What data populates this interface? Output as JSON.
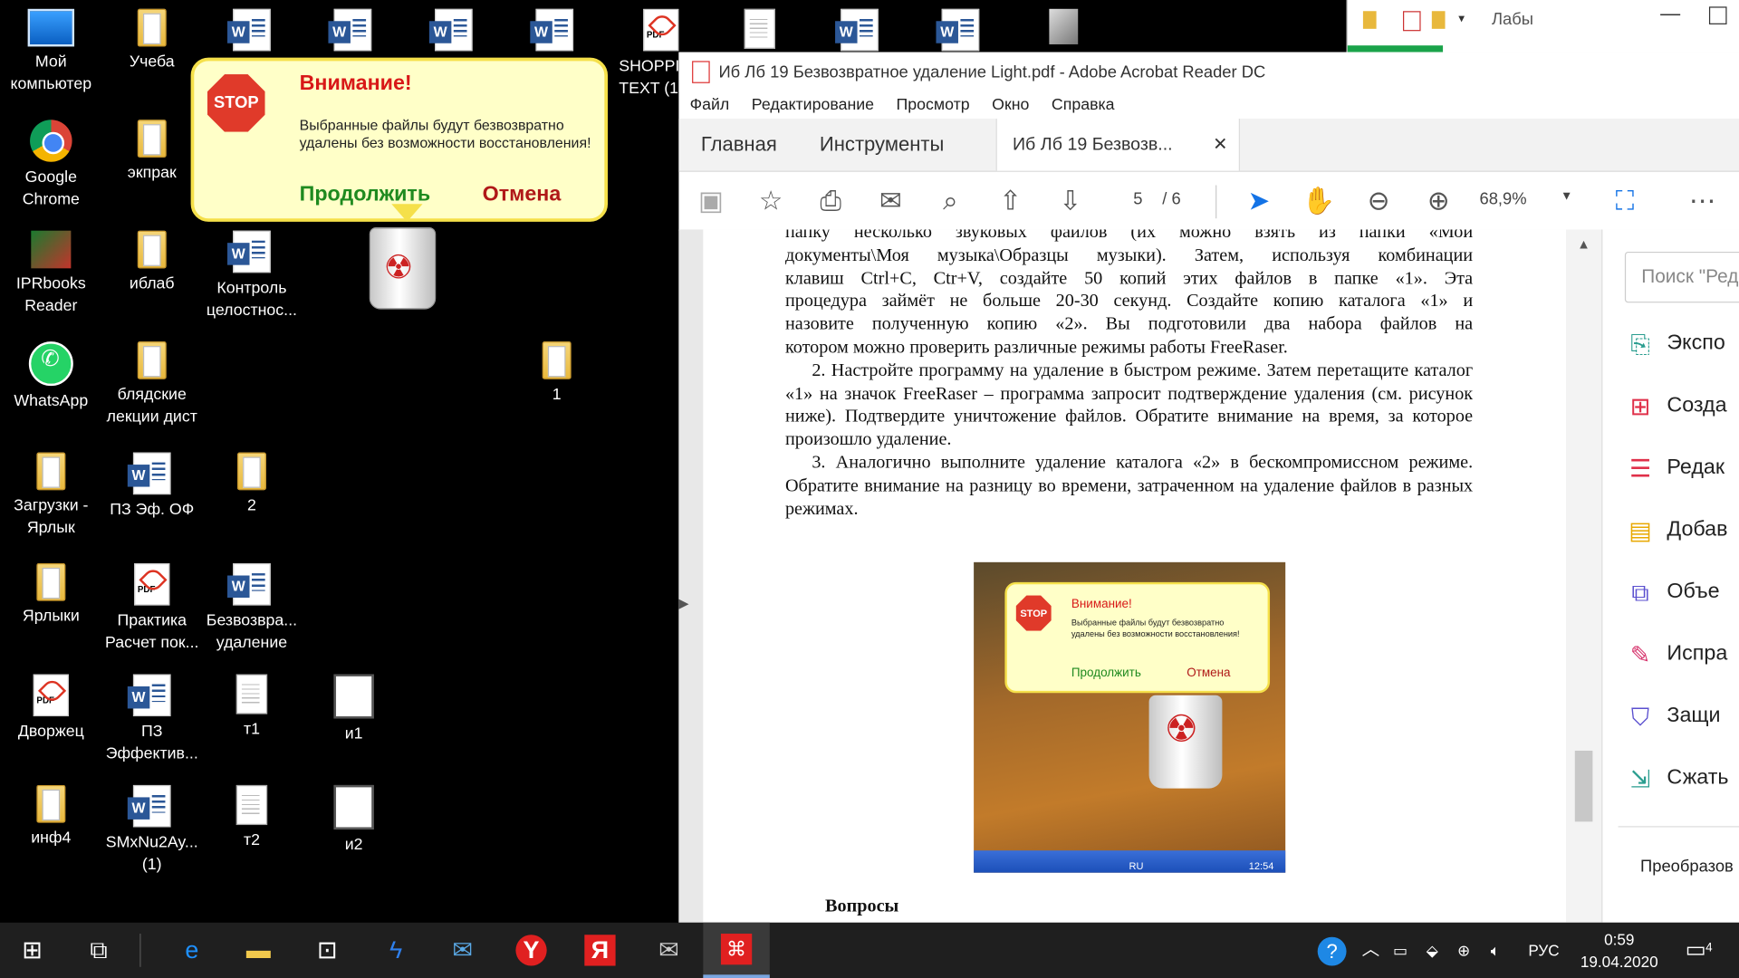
{
  "desktop": {
    "icons": [
      {
        "label": "Мой компьютер"
      },
      {
        "label": "Учеба"
      },
      {
        "label": "Google Chrome"
      },
      {
        "label": "экпрак"
      },
      {
        "label": "IPRbooks Reader"
      },
      {
        "label": "иблаб"
      },
      {
        "label": "Контроль целостнос..."
      },
      {
        "label": "WhatsApp"
      },
      {
        "label": "блядские лекции дист"
      },
      {
        "label": "1"
      },
      {
        "label": "Загрузки - Ярлык"
      },
      {
        "label": "ПЗ Эф. ОФ"
      },
      {
        "label": "2"
      },
      {
        "label": "Ярлыки"
      },
      {
        "label": "Практика Расчет пок..."
      },
      {
        "label": "Безвозвра... удаление"
      },
      {
        "label": "Дворжец"
      },
      {
        "label": "ПЗ Эффектив..."
      },
      {
        "label": "т1"
      },
      {
        "label": "и1"
      },
      {
        "label": "инф4"
      },
      {
        "label": "SMxNu2Ay... (1)"
      },
      {
        "label": "т2"
      },
      {
        "label": "и2"
      },
      {
        "label": "SHOPPI TEXT (1"
      }
    ]
  },
  "popup": {
    "stop": "STOP",
    "title": "Внимание!",
    "line1": "Выбранные файлы будут безвозвратно",
    "line2": "удалены без возможности восстановления!",
    "continue": "Продолжить",
    "cancel": "Отмена"
  },
  "explorer": {
    "title": "Лабы"
  },
  "acrobat": {
    "title": "Иб Лб 19 Безвозвратное удаление Light.pdf - Adobe Acrobat Reader DC",
    "menu": [
      "Файл",
      "Редактирование",
      "Просмотр",
      "Окно",
      "Справка"
    ],
    "tabs": {
      "home": "Главная",
      "tools": "Инструменты",
      "doc": "Иб Лб 19 Безвозв..."
    },
    "page_current": "5",
    "page_total": "/ 6",
    "zoom": "68,9%",
    "search_placeholder": "Поиск \"Ред",
    "right_tools": [
      "Экспо",
      "Созда",
      "Редак",
      "Добав",
      "Объе",
      "Испра",
      "Защи",
      "Сжать"
    ],
    "right_bottom": "Преобразов",
    "document": {
      "lines": [
        "папку несколько звуковых файлов (их можно взять из папки «Мои",
        "документы\\Моя музыка\\Образцы музыки). Затем, используя комбинации",
        "клавиш Ctrl+C, Ctr+V, создайте 50 копий этих файлов в папке «1». Эта",
        "процедура займёт не больше 20-30 секунд. Создайте копию каталога «1» и",
        "назовите полученную копию «2». Вы подготовили два набора файлов на",
        "котором можно проверить различные режимы работы FreeRaser."
      ],
      "p2": "2. Настройте программу на удаление в быстром режиме. Затем перетащите каталог «1» на значок FreeRaser – программа запросит подтверждение удаления (см. рисунок ниже). Подтвердите уничтожение файлов. Обратите внимание на время, за которое произошло удаление.",
      "p3": "3. Аналогично выполните удаление каталога «2» в бескомпромиссном режиме. Обратите внимание на разницу во времени, затраченном на удаление файлов в разных режимах.",
      "heading": "Вопросы",
      "figure": {
        "title": "Внимание!",
        "line1": "Выбранные файлы будут безвозвратно",
        "line2": "удалены без возможности восстановления!",
        "continue": "Продолжить",
        "cancel": "Отмена",
        "lang": "RU",
        "time": "12:54"
      }
    }
  },
  "taskbar": {
    "lang": "РУС",
    "time": "0:59",
    "date": "19.04.2020",
    "notifications": "4"
  }
}
